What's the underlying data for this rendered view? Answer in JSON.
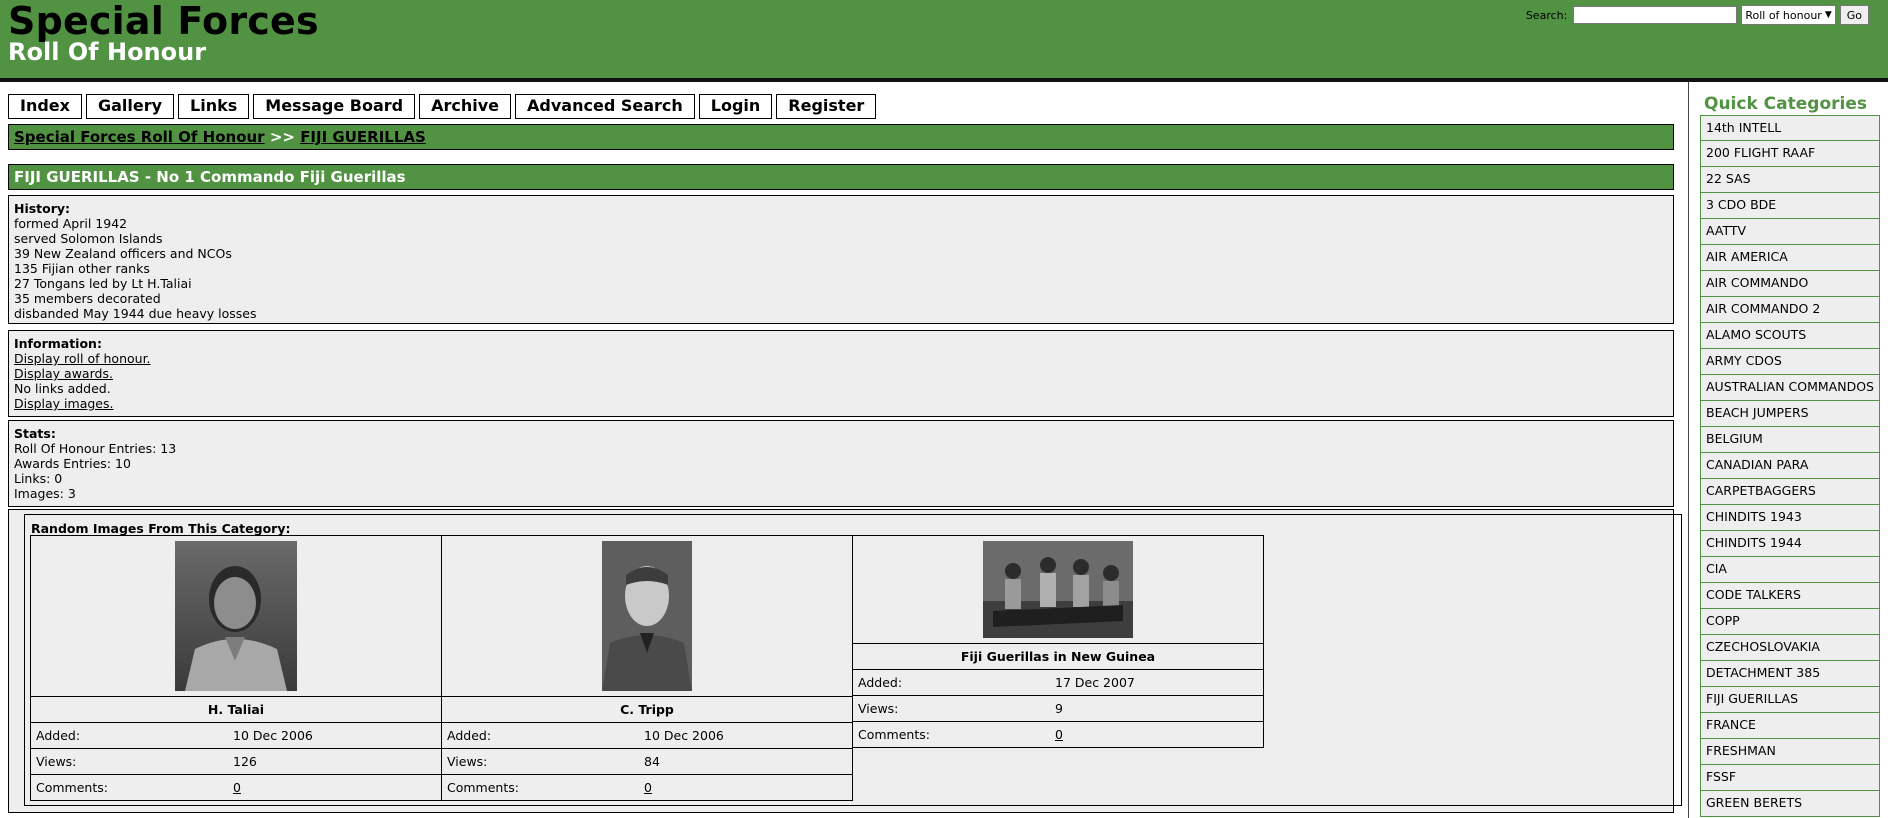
{
  "header": {
    "title": "Special Forces",
    "subtitle": "Roll Of Honour",
    "search_label": "Search:",
    "search_value": "",
    "search_scope": "Roll of honour",
    "go_label": "Go"
  },
  "nav": [
    "Index",
    "Gallery",
    "Links",
    "Message Board",
    "Archive",
    "Advanced Search",
    "Login",
    "Register"
  ],
  "breadcrumb": {
    "root": "Special Forces Roll Of Honour",
    "sep": ">>",
    "current": "FIJI GUERILLAS"
  },
  "category_title": "FIJI GUERILLAS - No 1 Commando Fiji Guerillas",
  "history": {
    "label": "History:",
    "lines": [
      "formed April 1942",
      "served Solomon Islands",
      "39 New Zealand officers and NCOs",
      "135 Fijian other ranks",
      "27 Tongans led by Lt H.Taliai",
      "35 members decorated",
      "disbanded May 1944 due heavy losses"
    ]
  },
  "information": {
    "label": "Information:",
    "roll_link": "Display roll of honour.",
    "awards_link": "Display awards.",
    "links_text": "No links added.",
    "images_link": "Display images."
  },
  "stats": {
    "label": "Stats:",
    "lines": [
      "Roll Of Honour Entries: 13",
      "Awards Entries: 10",
      "Links: 0",
      "Images: 3"
    ]
  },
  "random_images": {
    "title": "Random Images From This Category:",
    "added_label": "Added:",
    "views_label": "Views:",
    "comments_label": "Comments:",
    "items": [
      {
        "caption": "H. Taliai",
        "added": "10 Dec 2006",
        "views": "126",
        "comments": "0"
      },
      {
        "caption": "C. Tripp",
        "added": "10 Dec 2006",
        "views": "84",
        "comments": "0"
      },
      {
        "caption": "Fiji Guerillas in New Guinea",
        "added": "17 Dec 2007",
        "views": "9",
        "comments": "0"
      }
    ]
  },
  "sidebar": {
    "title": "Quick Categories",
    "categories": [
      "14th INTELL",
      "200 FLIGHT RAAF",
      "22 SAS",
      "3 CDO BDE",
      "AATTV",
      "AIR AMERICA",
      "AIR COMMANDO",
      "AIR COMMANDO 2",
      "ALAMO SCOUTS",
      "ARMY CDOS",
      "AUSTRALIAN COMMANDOS",
      "BEACH JUMPERS",
      "BELGIUM",
      "CANADIAN PARA",
      "CARPETBAGGERS",
      "CHINDITS 1943",
      "CHINDITS 1944",
      "CIA",
      "CODE TALKERS",
      "COPP",
      "CZECHOSLOVAKIA",
      "DETACHMENT 385",
      "FIJI GUERILLAS",
      "FRANCE",
      "FRESHMAN",
      "FSSF",
      "GREEN BERETS"
    ]
  },
  "colors": {
    "brand_green": "#519342",
    "panel_bg": "#eeeeee"
  }
}
